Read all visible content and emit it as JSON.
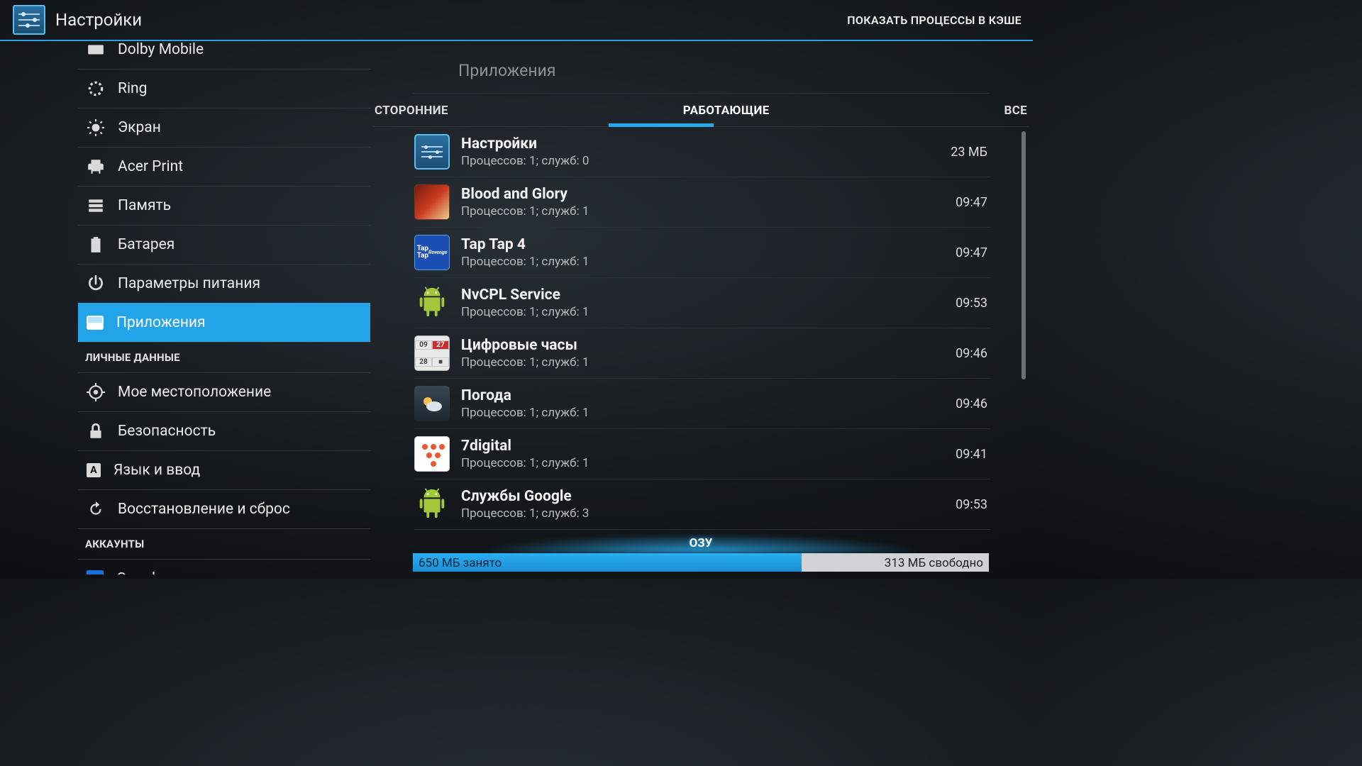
{
  "header": {
    "title": "Настройки",
    "action": "ПОКАЗАТЬ ПРОЦЕССЫ В КЭШЕ"
  },
  "sidebar": {
    "items": [
      {
        "id": "dolby",
        "label": "Dolby Mobile",
        "icon": "dolby"
      },
      {
        "id": "ring",
        "label": "Ring",
        "icon": "ring"
      },
      {
        "id": "screen",
        "label": "Экран",
        "icon": "sun"
      },
      {
        "id": "print",
        "label": "Acer Print",
        "icon": "printer"
      },
      {
        "id": "memory",
        "label": "Память",
        "icon": "storage"
      },
      {
        "id": "battery",
        "label": "Батарея",
        "icon": "battery"
      },
      {
        "id": "power",
        "label": "Параметры питания",
        "icon": "power"
      },
      {
        "id": "apps",
        "label": "Приложения",
        "icon": "apps",
        "selected": true
      }
    ],
    "section_personal": "ЛИЧНЫЕ ДАННЫЕ",
    "personal": [
      {
        "id": "location",
        "label": "Мое местоположение",
        "icon": "location"
      },
      {
        "id": "security",
        "label": "Безопасность",
        "icon": "lock"
      },
      {
        "id": "lang",
        "label": "Язык и ввод",
        "icon": "lang"
      },
      {
        "id": "reset",
        "label": "Восстановление и сброс",
        "icon": "restore"
      }
    ],
    "section_accounts": "АККАУНТЫ",
    "accounts": [
      {
        "id": "google",
        "label": "Google",
        "icon": "google"
      }
    ]
  },
  "content": {
    "heading": "Приложения",
    "tabs": {
      "thirdparty": "СТОРОННИЕ",
      "running": "РАБОТАЮЩИЕ",
      "all": "ВСЕ",
      "active": "running"
    },
    "apps": [
      {
        "name": "Настройки",
        "sub": "Процессов: 1; служб: 0",
        "meta": "23 МБ",
        "icon": "settings"
      },
      {
        "name": "Blood and Glory",
        "sub": "Процессов: 1; служб: 1",
        "meta": "09:47",
        "icon": "blood"
      },
      {
        "name": "Tap Tap 4",
        "sub": "Процессов: 1; служб: 1",
        "meta": "09:47",
        "icon": "tap"
      },
      {
        "name": "NvCPL Service",
        "sub": "Процессов: 1; служб: 1",
        "meta": "09:53",
        "icon": "android"
      },
      {
        "name": "Цифровые часы",
        "sub": "Процессов: 1; служб: 1",
        "meta": "09:46",
        "icon": "clock"
      },
      {
        "name": "Погода",
        "sub": "Процессов: 1; служб: 1",
        "meta": "09:46",
        "icon": "weather"
      },
      {
        "name": "7digital",
        "sub": "Процессов: 1; служб: 1",
        "meta": "09:41",
        "icon": "7d"
      },
      {
        "name": "Службы Google",
        "sub": "Процессов: 1; служб: 3",
        "meta": "09:53",
        "icon": "android"
      }
    ],
    "ram": {
      "label": "ОЗУ",
      "used_text": "650 МБ занято",
      "free_text": "313 МБ свободно",
      "used_pct": 67.5
    }
  }
}
